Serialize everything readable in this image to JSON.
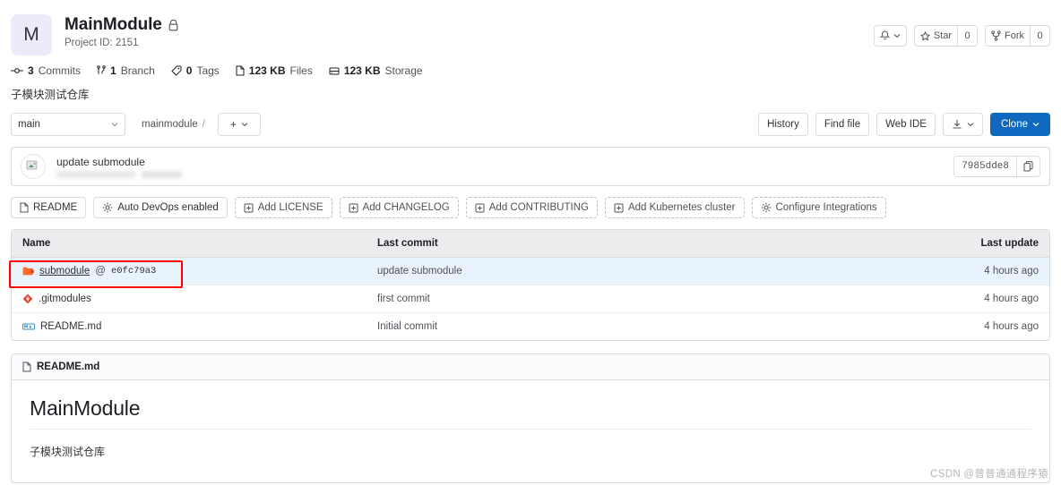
{
  "header": {
    "avatar_letter": "M",
    "title": "MainModule",
    "lock_icon": "lock-icon",
    "project_id": "Project ID: 2151",
    "notifications": {
      "icon": "bell-icon",
      "caret": "chevron-down-icon"
    },
    "star": {
      "label": "Star",
      "count": "0",
      "icon": "star-icon"
    },
    "fork": {
      "label": "Fork",
      "count": "0",
      "icon": "fork-icon"
    }
  },
  "stats": [
    {
      "icon": "commit-icon",
      "value": "3",
      "label": "Commits"
    },
    {
      "icon": "branch-icon",
      "value": "1",
      "label": "Branch"
    },
    {
      "icon": "tag-icon",
      "value": "0",
      "label": "Tags"
    },
    {
      "icon": "file-icon",
      "value": "123 KB",
      "label": "Files"
    },
    {
      "icon": "storage-icon",
      "value": "123 KB",
      "label": "Storage"
    }
  ],
  "description": "子模块测试仓库",
  "toolbar": {
    "branch": "main",
    "breadcrumb_root": "mainmodule",
    "breadcrumb_sep": "/",
    "add_label": "+",
    "history": "History",
    "find_file": "Find file",
    "web_ide": "Web IDE",
    "download_icon": "download-icon",
    "clone": "Clone"
  },
  "commit": {
    "message": "update submodule",
    "sha": "7985dde8",
    "copy_icon": "copy-icon"
  },
  "chips": [
    {
      "label": "README",
      "icon": "file-icon",
      "dashed": false
    },
    {
      "label": "Auto DevOps enabled",
      "icon": "gear-icon",
      "dashed": false
    },
    {
      "label": "Add LICENSE",
      "icon": "plus-square-icon",
      "dashed": true
    },
    {
      "label": "Add CHANGELOG",
      "icon": "plus-square-icon",
      "dashed": true
    },
    {
      "label": "Add CONTRIBUTING",
      "icon": "plus-square-icon",
      "dashed": true
    },
    {
      "label": "Add Kubernetes cluster",
      "icon": "plus-square-icon",
      "dashed": true
    },
    {
      "label": "Configure Integrations",
      "icon": "gear-icon",
      "dashed": true
    }
  ],
  "files": {
    "columns": {
      "name": "Name",
      "last_commit": "Last commit",
      "last_update": "Last update"
    },
    "rows": [
      {
        "icon": "submodule-folder-icon",
        "name": "submodule",
        "at": "@",
        "sha": "e0fc79a3",
        "last_commit": "update submodule",
        "last_update": "4 hours ago",
        "highlighted": true
      },
      {
        "icon": "git-icon",
        "name": ".gitmodules",
        "at": "",
        "sha": "",
        "last_commit": "first commit",
        "last_update": "4 hours ago",
        "highlighted": false
      },
      {
        "icon": "markdown-icon",
        "name": "README.md",
        "at": "",
        "sha": "",
        "last_commit": "Initial commit",
        "last_update": "4 hours ago",
        "highlighted": false
      }
    ]
  },
  "readme": {
    "filename": "README.md",
    "icon": "file-icon",
    "heading": "MainModule",
    "paragraph": "子模块测试仓库"
  },
  "watermark": "CSDN @普普通通程序猿",
  "colors": {
    "primary": "#1068bf",
    "annotation": "#ff0000",
    "row_highlight": "#e9f3fc",
    "avatar_bg": "#ebebfa"
  }
}
